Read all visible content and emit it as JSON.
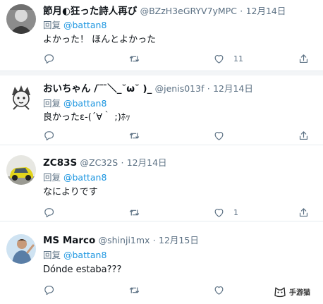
{
  "tweets": [
    {
      "name": "節月◐狂った詩人再び",
      "handle": "@BZzH3eGRYV7yMPC",
      "dot": "·",
      "date": "12月14日",
      "reply_prefix": "回复",
      "reply_to": "@battan8",
      "text": "よかった！ ほんとよかった",
      "replies": "",
      "retweets": "",
      "likes": "11"
    },
    {
      "name": "おいちゃん / ̄ ̄ ̄＼_˘ω˘ )_",
      "handle": "@jenis013f",
      "dot": "·",
      "date": "12月14日",
      "reply_prefix": "回复",
      "reply_to": "@battan8",
      "text": "良かったε-(´∀｀ ;)ﾎｯ",
      "replies": "",
      "retweets": "",
      "likes": ""
    },
    {
      "name": "ZC83S",
      "handle": "@ZC32S",
      "dot": "·",
      "date": "12月14日",
      "reply_prefix": "回复",
      "reply_to": "@battan8",
      "text": "なによりです",
      "replies": "",
      "retweets": "",
      "likes": "1"
    },
    {
      "name": "MS Marco",
      "handle": "@shinji1mx",
      "dot": "·",
      "date": "12月15日",
      "reply_prefix": "回复",
      "reply_to": "@battan8",
      "text": "Dónde estaba???",
      "replies": "",
      "retweets": "",
      "likes": ""
    }
  ],
  "icons": {
    "reply": "reply-icon",
    "retweet": "retweet-icon",
    "like": "heart-icon",
    "share": "share-icon"
  },
  "colors": {
    "link": "#1b95e0",
    "secondary_text": "#5b7083",
    "separator": "#e6ecf0"
  },
  "watermark": {
    "text": "手游猫"
  }
}
